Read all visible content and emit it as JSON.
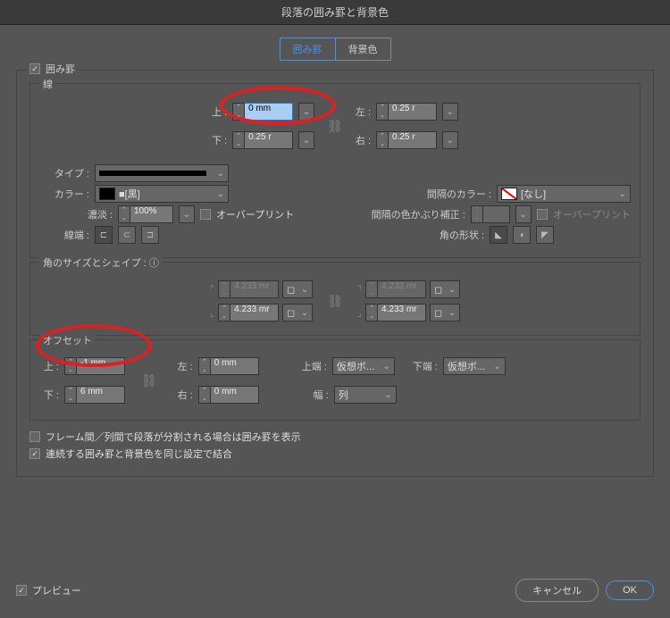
{
  "window": {
    "title": "段落の囲み罫と背景色"
  },
  "tabs": {
    "border": "囲み罫",
    "bg": "背景色"
  },
  "enable": {
    "label": "囲み罫"
  },
  "stroke": {
    "legend": "線",
    "top_label": "上 :",
    "top_value": "0 mm",
    "bottom_label": "下 :",
    "bottom_value": "0.25 r",
    "left_label": "左 :",
    "left_value": "0.25 r",
    "right_label": "右 :",
    "right_value": "0.25 r",
    "type_label": "タイプ :",
    "color_label": "カラー :",
    "color_value": "■[黒]",
    "gap_color_label": "間隔のカラー :",
    "gap_color_value": "[なし]",
    "tint_label": "濃淡 :",
    "tint_value": "100%",
    "overprint_label": "オーバープリント",
    "gap_tint_label": "間隔の色かぶり補正 :",
    "gap_overprint_label": "オーバープリント",
    "cap_label": "線端 :",
    "join_label": "角の形状 :"
  },
  "corners": {
    "legend": "角のサイズとシェイプ :",
    "tl": "4.233 mr",
    "tr": "4.233 mr",
    "bl": "4.233 mr",
    "br": "4.233 mr"
  },
  "offset": {
    "legend": "オフセット",
    "top_label": "上 :",
    "top_value": "-1 mm",
    "bottom_label": "下 :",
    "bottom_value": "6 mm",
    "left_label": "左 :",
    "left_value": "0 mm",
    "right_label": "右 :",
    "right_value": "0 mm",
    "topedge_label": "上端 :",
    "topedge_value": "仮想ボ...",
    "bottomedge_label": "下端 :",
    "bottomedge_value": "仮想ボ...",
    "width_label": "幅 :",
    "width_value": "列"
  },
  "opts": {
    "split_label": "フレーム間／列間で段落が分割される場合は囲み罫を表示",
    "merge_label": "連続する囲み罫と背景色を同じ設定で結合"
  },
  "footer": {
    "preview": "プレビュー",
    "cancel": "キャンセル",
    "ok": "OK"
  }
}
